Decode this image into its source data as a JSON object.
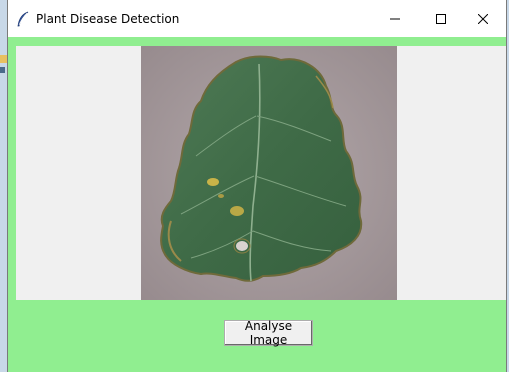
{
  "window": {
    "title": "Plant Disease Detection",
    "controls": {
      "minimize_icon": "minimize-icon",
      "maximize_icon": "maximize-icon",
      "close_icon": "close-icon"
    }
  },
  "main": {
    "background_color": "#90ee90",
    "image_panel_color": "#f0f0f0",
    "image": {
      "subject": "tomato leaf with spots"
    },
    "analyse_button_label": "Analyse Image"
  }
}
